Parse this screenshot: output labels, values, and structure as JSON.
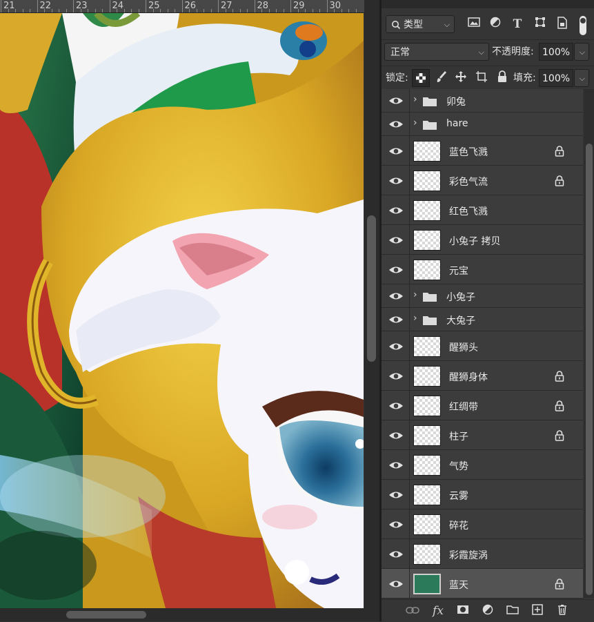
{
  "ruler": {
    "numbers": [
      "21",
      "22",
      "23",
      "24",
      "25",
      "26",
      "27",
      "28",
      "29",
      "30"
    ]
  },
  "panel": {
    "filter": {
      "kind_label": "类型",
      "kind_icon": "search-icon",
      "filter_icons": [
        "image-filter-icon",
        "adjustment-filter-icon",
        "type-filter-icon",
        "shape-filter-icon",
        "smart-object-filter-icon"
      ]
    },
    "blend": {
      "mode": "正常",
      "opacity_label": "不透明度:",
      "opacity_value": "100%"
    },
    "lock": {
      "label": "锁定:",
      "fill_label": "填充:",
      "fill_value": "100%"
    }
  },
  "layers": [
    {
      "type": "group",
      "name": "卯兔"
    },
    {
      "type": "group",
      "name": "hare"
    },
    {
      "type": "layer",
      "name": "蓝色飞溅",
      "locked": true
    },
    {
      "type": "layer",
      "name": "彩色气流",
      "locked": true
    },
    {
      "type": "layer",
      "name": "红色飞溅",
      "locked": false
    },
    {
      "type": "layer",
      "name": "小兔子 拷贝",
      "locked": false
    },
    {
      "type": "layer",
      "name": "元宝",
      "locked": false
    },
    {
      "type": "group",
      "name": "小兔子"
    },
    {
      "type": "group",
      "name": "大兔子"
    },
    {
      "type": "layer",
      "name": "醒狮头",
      "locked": false
    },
    {
      "type": "layer",
      "name": "醒狮身体",
      "locked": true
    },
    {
      "type": "layer",
      "name": "红绸带",
      "locked": true
    },
    {
      "type": "layer",
      "name": "柱子",
      "locked": true
    },
    {
      "type": "layer",
      "name": "气势",
      "locked": false
    },
    {
      "type": "layer",
      "name": "云雾",
      "locked": false
    },
    {
      "type": "layer",
      "name": "碎花",
      "locked": false
    },
    {
      "type": "layer",
      "name": "彩霞旋涡",
      "locked": false
    },
    {
      "type": "layer",
      "name": "蓝天",
      "locked": true,
      "selected": true
    }
  ],
  "bottom_bar": {
    "fx_label": "fx",
    "icons": [
      "link-layers-icon",
      "fx-icon",
      "add-mask-icon",
      "adjustment-layer-icon",
      "new-group-icon",
      "new-layer-icon",
      "delete-layer-icon"
    ]
  }
}
